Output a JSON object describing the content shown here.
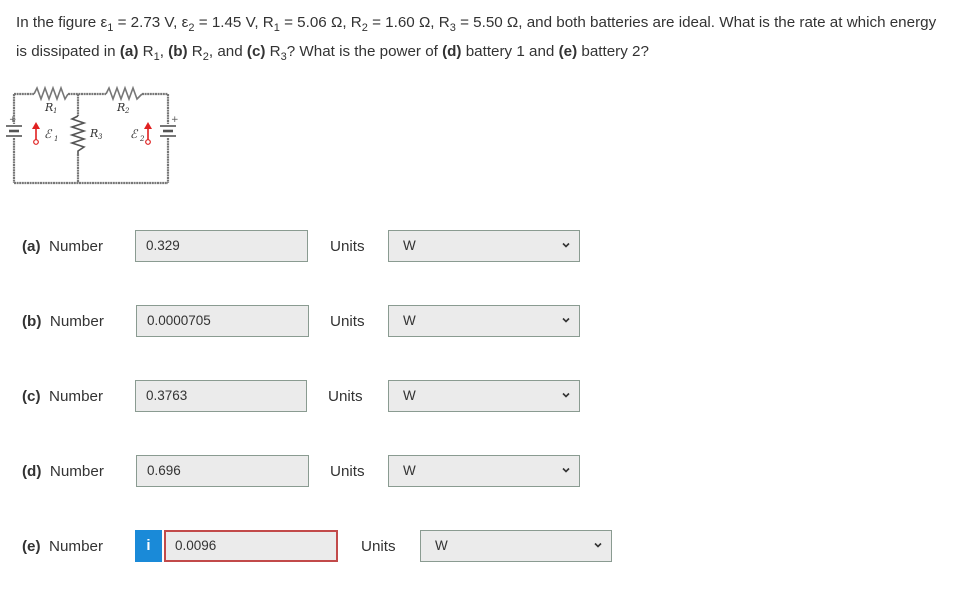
{
  "question": {
    "line1_a": "In the figure ",
    "e1": "ε",
    "e1_sub": "1",
    "line1_b": " = 2.73 V, ",
    "e2": "ε",
    "e2_sub": "2",
    "line1_c": " = 1.45 V, ",
    "r1": "R",
    "r1_sub": "1",
    "line1_d": " = 5.06 Ω, ",
    "r2": "R",
    "r2_sub": "2",
    "line1_e": " = 1.60 Ω, ",
    "r3": "R",
    "r3_sub": "3",
    "line1_f": " = 5.50 Ω, and both batteries are ideal. What is the rate at which energy",
    "line2_a": "is dissipated in ",
    "pa": "(a)",
    "line2_b": " R",
    "line2_b_sub": "1",
    "line2_c": ", ",
    "pb": "(b)",
    "line2_d": " R",
    "line2_d_sub": "2",
    "line2_e": ", and ",
    "pc": "(c)",
    "line2_f": " R",
    "line2_f_sub": "3",
    "line2_g": "? What is the power of ",
    "pd": "(d)",
    "line2_h": " battery 1 and ",
    "pe": "(e)",
    "line2_i": " battery 2?"
  },
  "circuit": {
    "labels": {
      "R1": "R",
      "R1_sub": "1",
      "R2": "R",
      "R2_sub": "2",
      "R3": "R",
      "R3_sub": "3",
      "E1": "ℰ",
      "E1_sub": "1",
      "E2": "ℰ",
      "E2_sub": "2",
      "plus_left": "+",
      "plus_right": "+"
    }
  },
  "answers": [
    {
      "part": "(a)",
      "label": "Number",
      "value": "0.329",
      "units_label": "Units",
      "unit": "W",
      "error": false,
      "info": false
    },
    {
      "part": "(b)",
      "label": "Number",
      "value": "0.0000705",
      "units_label": "Units",
      "unit": "W",
      "error": false,
      "info": false
    },
    {
      "part": "(c)",
      "label": "Number",
      "value": "0.3763",
      "units_label": "Units",
      "unit": "W",
      "error": false,
      "info": false
    },
    {
      "part": "(d)",
      "label": "Number",
      "value": "0.696",
      "units_label": "Units",
      "unit": "W",
      "error": false,
      "info": false
    },
    {
      "part": "(e)",
      "label": "Number",
      "value": "0.0096",
      "units_label": "Units",
      "unit": "W",
      "error": true,
      "info": true,
      "info_glyph": "i"
    }
  ],
  "colors": {
    "text": "#333333",
    "field_bg": "#ebebeb",
    "field_border": "#8a9b91",
    "error_border": "#c24a4a",
    "info_blue": "#1a8ad8",
    "circuit_wire": "#777777",
    "battery_arrow": "#e02020"
  }
}
